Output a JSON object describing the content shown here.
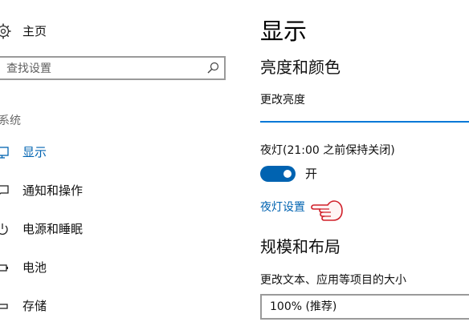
{
  "sidebar": {
    "home_label": "主页",
    "search_placeholder": "查找设置",
    "group_label": "系统",
    "items": [
      {
        "label": "显示",
        "icon": "monitor-icon",
        "active": true
      },
      {
        "label": "通知和操作",
        "icon": "speech-bubble-icon"
      },
      {
        "label": "电源和睡眠",
        "icon": "power-icon"
      },
      {
        "label": "电池",
        "icon": "battery-icon"
      },
      {
        "label": "存储",
        "icon": "storage-icon"
      }
    ]
  },
  "main": {
    "title": "显示",
    "brightness_section": "亮度和颜色",
    "brightness_label": "更改亮度",
    "night_light_label": "夜灯(21:00 之前保持关闭)",
    "toggle_state": "开",
    "night_light_link": "夜灯设置",
    "layout_section": "规模和布局",
    "scale_label": "更改文本、应用等项目的大小",
    "scale_value": "100% (推荐)"
  },
  "colors": {
    "accent": "#0063b1",
    "slider": "#0078d7",
    "hand_cursor": "#d0202a"
  }
}
